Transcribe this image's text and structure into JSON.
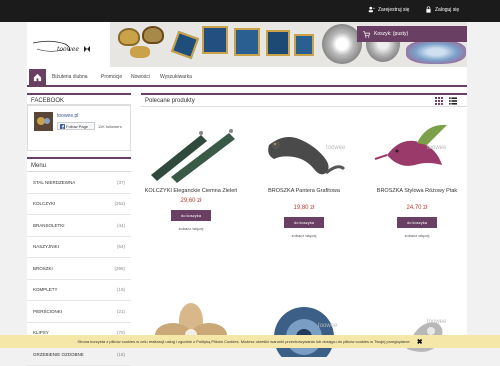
{
  "topbar": {
    "register_label": "Zarejestruj się",
    "login_label": "Zaloguj się"
  },
  "header": {
    "logo_text": "toowee",
    "cart_label": "Koszyk: (pusty)"
  },
  "nav": {
    "items": [
      "Biżuteria ślubna",
      "Promocje",
      "Nowości",
      "Wyszukiwarka"
    ]
  },
  "facebook": {
    "title": "FACEBOOK",
    "page_name": "toowee.pl",
    "follow_label": "Follow Page",
    "followers": "11K followers"
  },
  "menu": {
    "title": "Menu",
    "items": [
      {
        "label": "STAL NIERDZEWNA",
        "count": "(37)"
      },
      {
        "label": "KOLCZYKI",
        "count": "(252)"
      },
      {
        "label": "BRANSOLETKI",
        "count": "(44)"
      },
      {
        "label": "NASZYJNIKI",
        "count": "(64)"
      },
      {
        "label": "BROSZKI",
        "count": "(296)"
      },
      {
        "label": "KOMPLETY",
        "count": "(19)"
      },
      {
        "label": "PIERŚCIONKI",
        "count": "(21)"
      },
      {
        "label": "KLIPSY",
        "count": "(75)"
      },
      {
        "label": "GRZEBIENIE OZDOBNE",
        "count": "(18)"
      }
    ]
  },
  "main": {
    "title": "Polecane produkty",
    "watermark": "toowee",
    "products": [
      {
        "name": "KOLCZYKI Eleganckie Ciemna Zieleń",
        "price": "29,60 zł",
        "button": "do koszyka",
        "more": "zobacz więcej"
      },
      {
        "name": "BROSZKA Pantera Grafitowa",
        "price": "19,80 zł",
        "button": "do koszyka",
        "more": "zobacz więcej"
      },
      {
        "name": "BROSZKA Stylowa Różowy Ptak",
        "price": "24,70 zł",
        "button": "do koszyka",
        "more": "zobacz więcej"
      }
    ]
  },
  "cookie": {
    "text": "Strona korzysta z plików cookies w celu realizacji usług i zgodnie z Polityką Plików Cookies. Możesz określić warunki przechowywania lub dostępu do plików cookies w Twojej przeglądarce.",
    "close": "✖"
  },
  "colors": {
    "accent": "#6a3f64",
    "price": "#c0392b",
    "cookie_bg": "#f5e7a8"
  }
}
